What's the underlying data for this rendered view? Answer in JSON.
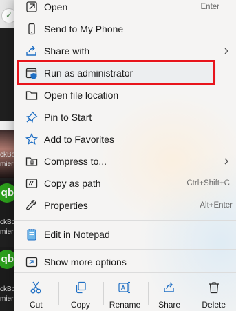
{
  "menu": {
    "items": [
      {
        "label": "Open",
        "shortcut": "Enter",
        "icon": "open-window-icon"
      },
      {
        "label": "Send to My Phone",
        "icon": "phone-icon"
      },
      {
        "label": "Share with",
        "icon": "share-icon",
        "submenu": true
      },
      {
        "label": "Run as administrator",
        "icon": "shield-admin-icon",
        "highlighted": true
      },
      {
        "label": "Open file location",
        "icon": "folder-icon"
      },
      {
        "label": "Pin to Start",
        "icon": "pin-icon"
      },
      {
        "label": "Add to Favorites",
        "icon": "star-icon"
      },
      {
        "label": "Compress to...",
        "icon": "zip-folder-icon",
        "submenu": true
      },
      {
        "label": "Copy as path",
        "shortcut": "Ctrl+Shift+C",
        "icon": "copy-path-icon"
      },
      {
        "label": "Properties",
        "shortcut": "Alt+Enter",
        "icon": "wrench-icon"
      },
      {
        "label": "Edit in Notepad",
        "icon": "notepad-icon"
      },
      {
        "label": "Show more options",
        "icon": "expand-icon"
      }
    ]
  },
  "actions": [
    {
      "label": "Cut",
      "icon": "scissors-icon"
    },
    {
      "label": "Copy",
      "icon": "copy-icon"
    },
    {
      "label": "Rename",
      "icon": "rename-icon"
    },
    {
      "label": "Share",
      "icon": "share-icon"
    },
    {
      "label": "Delete",
      "icon": "trash-icon"
    }
  ],
  "background": {
    "tiles": [
      {
        "lines": [
          "ckBo",
          "mier"
        ]
      },
      {
        "lines": [
          "ckBo",
          "mier"
        ]
      },
      {
        "lines": [
          "ckBo",
          "mier"
        ]
      }
    ],
    "logo_text": "qb"
  },
  "colors": {
    "highlight_border": "#e8141c",
    "accent_blue": "#1f6fc4",
    "quickbooks_green": "#2ca01c"
  }
}
